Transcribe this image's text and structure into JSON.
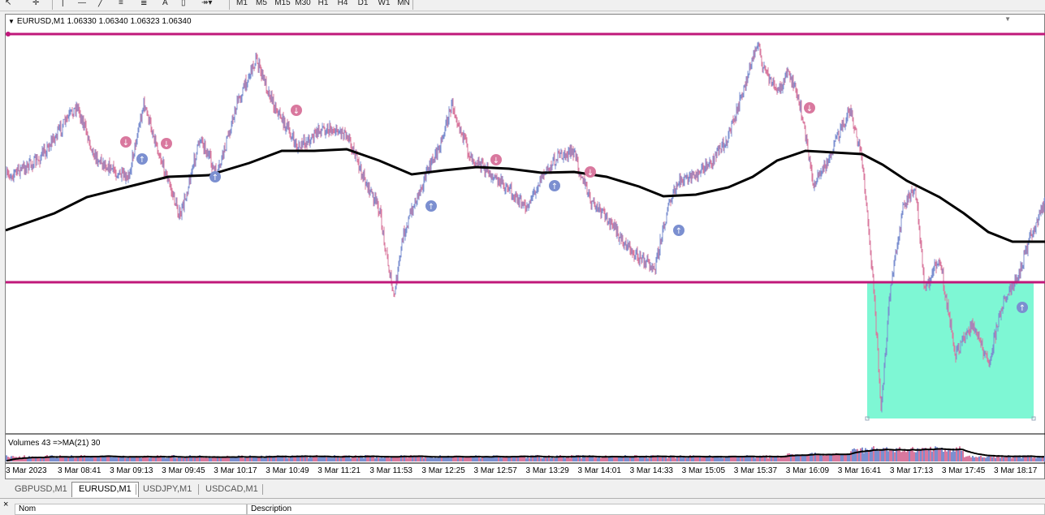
{
  "toolbar": {
    "timeframes": [
      "M1",
      "M5",
      "M15",
      "M30",
      "H1",
      "H4",
      "D1",
      "W1",
      "MN"
    ],
    "text_tool_label": "A"
  },
  "chart": {
    "title": "EURUSD,M1  1.06330 1.06340 1.06323 1.06340",
    "volume_label": "Volumes 43  =>MA(21) 30",
    "time_labels": [
      "3 Mar 2023",
      "3 Mar 08:41",
      "3 Mar 09:13",
      "3 Mar 09:45",
      "3 Mar 10:17",
      "3 Mar 10:49",
      "3 Mar 11:21",
      "3 Mar 11:53",
      "3 Mar 12:25",
      "3 Mar 12:57",
      "3 Mar 13:29",
      "3 Mar 14:01",
      "3 Mar 14:33",
      "3 Mar 15:05",
      "3 Mar 15:37",
      "3 Mar 16:09",
      "3 Mar 16:41",
      "3 Mar 17:13",
      "3 Mar 17:45",
      "3 Mar 18:17"
    ],
    "colors": {
      "bull": "#7b8fd0",
      "bear": "#d9789e",
      "ma": "#000000",
      "hline": "#c0187a",
      "rect": "#7ef7d4"
    }
  },
  "tabs": {
    "items": [
      "GBPUSD,M1",
      "EURUSD,M1",
      "USDJPY,M1",
      "USDCAD,M1"
    ],
    "active": "EURUSD,M1"
  },
  "bottom": {
    "close_label": "×",
    "col_name": "Nom",
    "col_desc": "Description"
  }
}
